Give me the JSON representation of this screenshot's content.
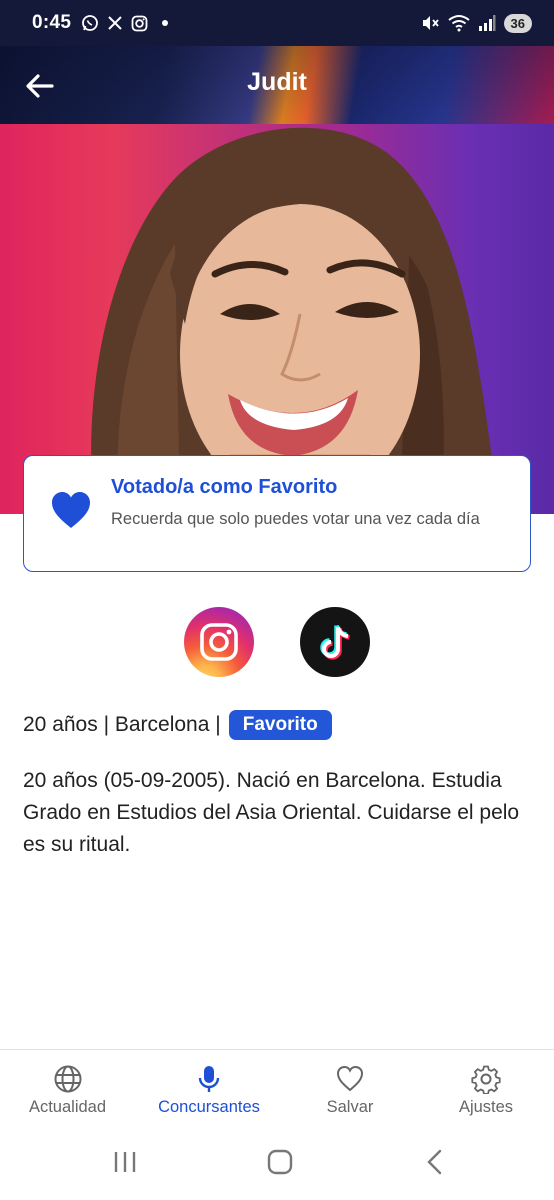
{
  "status_bar": {
    "time": "0:45",
    "battery": "36",
    "left_icons": [
      "whatsapp-icon",
      "x-icon",
      "instagram-icon",
      "dot"
    ],
    "right_icons": [
      "mute-icon",
      "wifi-icon",
      "signal-icon",
      "battery-icon"
    ]
  },
  "header": {
    "title": "Judit"
  },
  "vote_card": {
    "title": "Votado/a como Favorito",
    "text": "Recuerda que solo puedes votar una vez cada día"
  },
  "socials": [
    "instagram",
    "tiktok"
  ],
  "info": {
    "line": "20 años | Barcelona |",
    "badge": "Favorito"
  },
  "bio": "20 años (05-09-2005). Nació en Barcelona. Estudia Grado en Estudios del Asia Oriental. Cuidarse el pelo es su ritual.",
  "bottom_nav": [
    {
      "label": "Actualidad",
      "icon": "globe-icon",
      "active": false
    },
    {
      "label": "Concursantes",
      "icon": "microphone-icon",
      "active": true
    },
    {
      "label": "Salvar",
      "icon": "heart-icon",
      "active": false
    },
    {
      "label": "Ajustes",
      "icon": "gear-icon",
      "active": false
    }
  ],
  "colors": {
    "accent": "#1f4fd6",
    "badge": "#2456d8",
    "status_bar": "#14193a"
  }
}
